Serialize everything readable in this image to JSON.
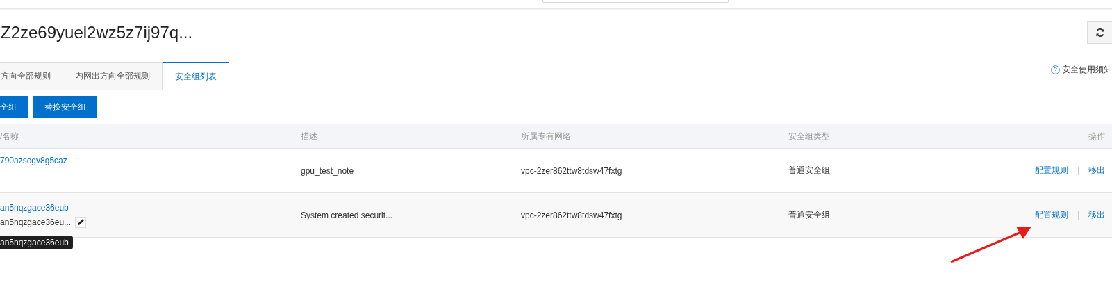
{
  "title": "Z2ze69yuel2wz5z7ij97q...",
  "tabs": [
    {
      "label": "方向全部规则",
      "selected": false
    },
    {
      "label": "内网出方向全部规则",
      "selected": false
    },
    {
      "label": "安全组列表",
      "selected": true
    }
  ],
  "help_link": "安全使用须知",
  "buttons": [
    "全组",
    "替换安全组"
  ],
  "table": {
    "columns": [
      "/名称",
      "描述",
      "所属专有网络",
      "安全组类型",
      "操作"
    ],
    "rows": [
      {
        "id": "790azsogv8g5caz",
        "description": "gpu_test_note",
        "vpc": "vpc-2zer862ttw8tdsw47fxtg",
        "type": "普通安全组",
        "actions": [
          "配置规则",
          "移出"
        ]
      },
      {
        "id": "an5nqzgace36eub",
        "name": "an5nqzgace36eu...",
        "tooltip": "an5nqzgace36eub",
        "description": "System created securit...",
        "vpc": "vpc-2zer862ttw8tdsw47fxtg",
        "type": "普通安全组",
        "actions": [
          "配置规则",
          "移出"
        ]
      }
    ]
  }
}
